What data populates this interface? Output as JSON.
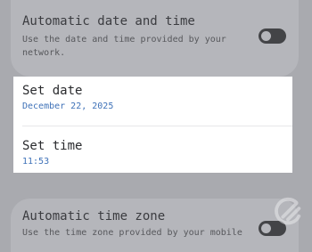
{
  "settings": {
    "auto_date_time": {
      "title": "Automatic date and time",
      "desc_line1": "Use the date and time provided by your",
      "desc_line2": "network.",
      "toggle_on": false
    },
    "set_date": {
      "title": "Set date",
      "value": "December 22, 2025"
    },
    "set_time": {
      "title": "Set time",
      "value": "11:53"
    },
    "auto_time_zone": {
      "title": "Automatic time zone",
      "desc_line1": "Use the time zone provided by your mobile",
      "toggle_on": false
    }
  },
  "colors": {
    "dim_background": "#a9aaaf",
    "card_dim": "#b5b6bb",
    "card_focus": "#ffffff",
    "accent": "#3f72b8",
    "toggle_off_track": "#434447"
  },
  "icons": {
    "watermark": "g-logo-icon"
  }
}
